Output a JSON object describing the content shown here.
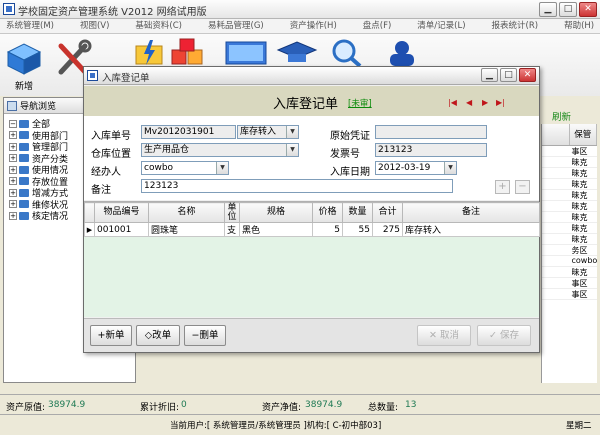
{
  "app": {
    "title": "学校固定资产管理系统 V2012 网络试用版",
    "menu": [
      "系统管理(M)",
      "视图(V)",
      "基础资料(C)",
      "易耗品管理(G)",
      "资产操作(H)",
      "盘点(F)",
      "清单/记录(L)",
      "报表统计(R)",
      "帮助(H)"
    ],
    "toolbar": {
      "new_label": "新增",
      "edit_label": "修"
    }
  },
  "nav": {
    "tab_label": "导航浏览",
    "items": [
      "全部",
      "使用部门",
      "管理部门",
      "资产分类",
      "使用情况",
      "存放位置",
      "增减方式",
      "维修状况",
      "核定情况"
    ]
  },
  "bg_grid": {
    "refresh_label": "刷新",
    "col_header": "保管",
    "rows": [
      "事区",
      "昧克",
      "昧克",
      "昧克",
      "昧克",
      "昧克",
      "昧克",
      "昧克",
      "昧克",
      "务区",
      "cowbo",
      "昧克",
      "事区",
      "事区"
    ]
  },
  "dialog": {
    "title": "入库登记单",
    "header_title": "入库登记单",
    "status_tag": "[未审]",
    "fields": {
      "receipt_no_label": "入库单号",
      "receipt_no": "Mv2012031901",
      "receipt_type": "库存转入",
      "original_voucher_label": "原始凭证",
      "original_voucher": "",
      "warehouse_label": "仓库位置",
      "warehouse": "生产用品仓",
      "invoice_label": "发票号",
      "invoice": "213123",
      "handler_label": "经办人",
      "handler": "cowbo",
      "date_label": "入库日期",
      "date": "2012-03-19",
      "remark_label": "备注",
      "remark": "123123"
    },
    "table": {
      "columns": [
        "物品编号",
        "名称",
        "单位",
        "规格",
        "价格",
        "数量",
        "合计",
        "备注"
      ],
      "rows": [
        [
          "001001",
          "圆珠笔",
          "支",
          "黑色",
          "5",
          "55",
          "275",
          "库存转入"
        ]
      ]
    },
    "buttons": {
      "new": "+新单",
      "edit": "◇改单",
      "delete": "−删单",
      "cancel": "取消",
      "save": "保存"
    }
  },
  "status": {
    "original_value_label": "资产原值:",
    "original_value": "38974.9",
    "depreciation_label": "累计折旧:",
    "depreciation": "0",
    "net_value_label": "资产净值:",
    "net_value": "38974.9",
    "total_qty_label": "总数量:",
    "total_qty": "13",
    "user_info": "当前用户:[ 系统管理员/系统管理员 ]机构:[ C-初中部03]",
    "weekday": "星期二"
  }
}
